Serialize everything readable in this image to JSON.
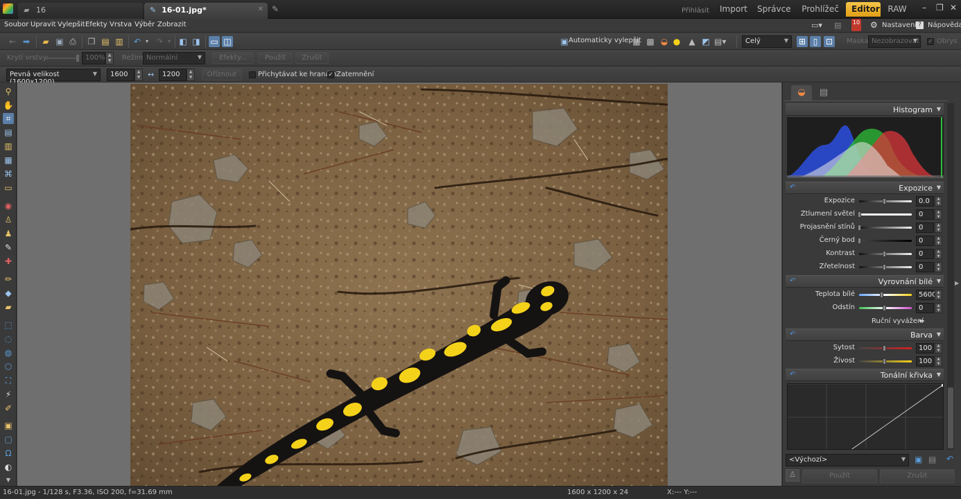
{
  "titlebar": {
    "tab_folder": "16",
    "tab_file": "16-01.jpg*",
    "login": "Přihlásit",
    "modes": [
      "Import",
      "Správce",
      "Prohlížeč",
      "Editor",
      "RAW"
    ],
    "win_minimize": "–",
    "win_restore": "❐",
    "win_close": "✕"
  },
  "menubar": {
    "items": [
      "Soubor",
      "Upravit",
      "Vylepšit",
      "Efekty",
      "Vrstva",
      "Výběr",
      "Zobrazit"
    ],
    "badge_count": "10",
    "settings_label": "Nastavení",
    "help_label": "Nápověda"
  },
  "toolbar": {
    "auto_enhance": "Automaticky vylepšit",
    "zoom_select": "Celý",
    "mask_label": "Maska:",
    "mask_value": "Nezobrazovat",
    "outline_label": "Obrys"
  },
  "layerbar": {
    "opacity_label": "Krytí vrstvy:",
    "opacity_value": "100%",
    "mode_label": "Režim:",
    "mode_value": "Normální",
    "effects": "Efekty...",
    "apply": "Použít",
    "cancel": "Zrušit"
  },
  "cropbar": {
    "preset": "Pevná velikost (1600x1200)",
    "width": "1600",
    "height": "1200",
    "crop_button": "Oříznout",
    "snap_label": "Přichytávat ke hranám",
    "darken_label": "Zatemnění",
    "snap_checked": false,
    "darken_checked": true
  },
  "panel": {
    "histogram_title": "Histogram",
    "exposure_title": "Expozice",
    "sliders_exposure": [
      {
        "label": "Expozice",
        "value": "0.0",
        "pos": 0.5
      },
      {
        "label": "Ztlumení světel",
        "value": "0",
        "pos": 0.0
      },
      {
        "label": "Projasnění stínů",
        "value": "0",
        "pos": 0.0
      },
      {
        "label": "Černý bod",
        "value": "0",
        "pos": 0.0
      },
      {
        "label": "Kontrast",
        "value": "0",
        "pos": 0.5
      },
      {
        "label": "Zřetelnost",
        "value": "0",
        "pos": 0.5
      }
    ],
    "wb_title": "Vyrovnání bílé",
    "sliders_wb": [
      {
        "label": "Teplota bílé",
        "value": "5600",
        "pos": 0.45
      },
      {
        "label": "Odstín",
        "value": "0",
        "pos": 0.5
      }
    ],
    "manual_wb": "Ruční vyvážení",
    "color_title": "Barva",
    "sliders_color": [
      {
        "label": "Sytost",
        "value": "100",
        "pos": 0.5
      },
      {
        "label": "Živost",
        "value": "100",
        "pos": 0.5
      }
    ],
    "curve_title": "Tonální křivka",
    "preset_value": "<Výchozí>",
    "apply": "Použít",
    "cancel": "Zrušit"
  },
  "status": {
    "file_info": "16-01.jpg - 1/128 s, F3.36, ISO 200, f=31.69 mm",
    "dimensions": "1600 x 1200 x 24",
    "coords": "X:---  Y:---"
  },
  "colors": {
    "accent": "#f0b429",
    "panel_bg": "#3a3a3a",
    "canvas_bg": "#6f6f6f",
    "salamander_yellow": "#f5d21a"
  }
}
